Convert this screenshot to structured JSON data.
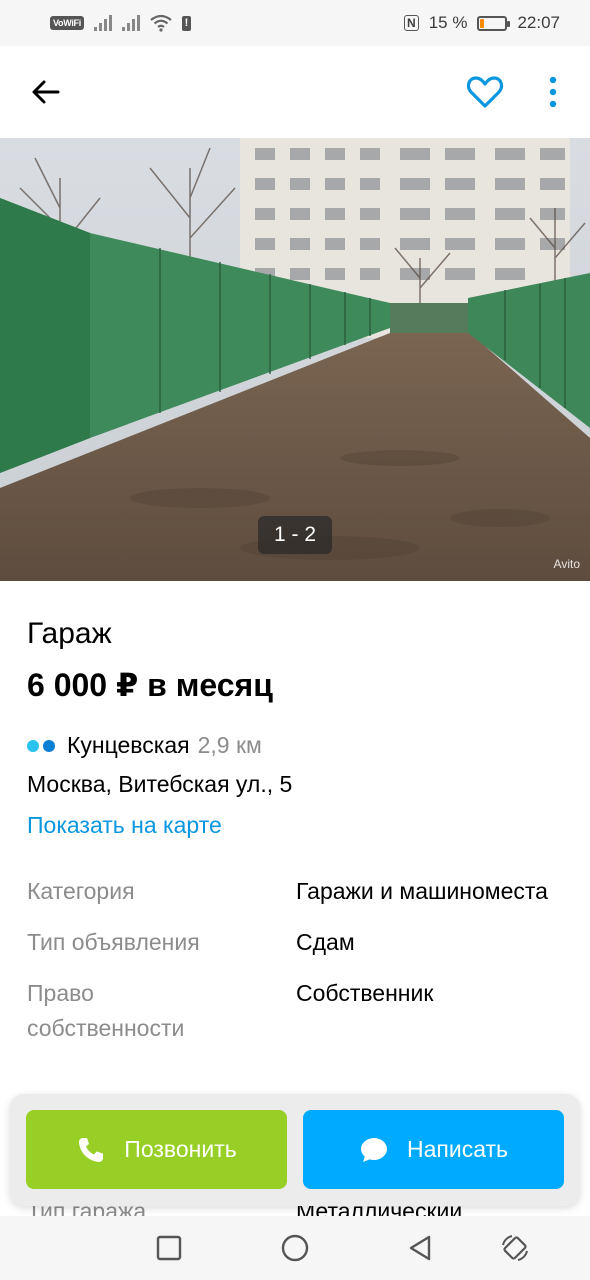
{
  "status_bar": {
    "network_badge": "VoWiFi",
    "nfc": "N",
    "battery_percent": "15 %",
    "battery_level": 0.15,
    "time": "22:07",
    "alert": "!"
  },
  "app_bar": {
    "back_icon": "arrow-left-icon",
    "favorite_icon": "heart-outline-icon",
    "more_icon": "more-vertical-icon",
    "accent_color": "#0a97e0"
  },
  "gallery": {
    "counter": "1 - 2",
    "watermark": "Avito",
    "description_icon": "photo"
  },
  "listing": {
    "title": "Гараж",
    "price": "6 000 ₽ в месяц",
    "metro": {
      "dot_colors": [
        "#2bc2f0",
        "#0a7fd6"
      ],
      "station": "Кунцевская",
      "distance": "2,9 км"
    },
    "address": "Москва, Витебская ул., 5",
    "map_link": "Показать на карте"
  },
  "params": [
    {
      "key": "Категория",
      "value": "Гаражи и машиноместа"
    },
    {
      "key": "Тип объявления",
      "value": "Сдам"
    },
    {
      "key": "Право собственности",
      "value": "Собственник"
    }
  ],
  "partial_row": {
    "key": "Тип гаража",
    "value": "Металлический"
  },
  "actions": {
    "call_label": "Позвонить",
    "call_color": "#97cf26",
    "write_label": "Написать",
    "write_color": "#00aaff"
  },
  "nav_bar": {
    "icons": [
      "recents-square-icon",
      "home-circle-icon",
      "back-triangle-icon",
      "rotate-icon"
    ]
  }
}
